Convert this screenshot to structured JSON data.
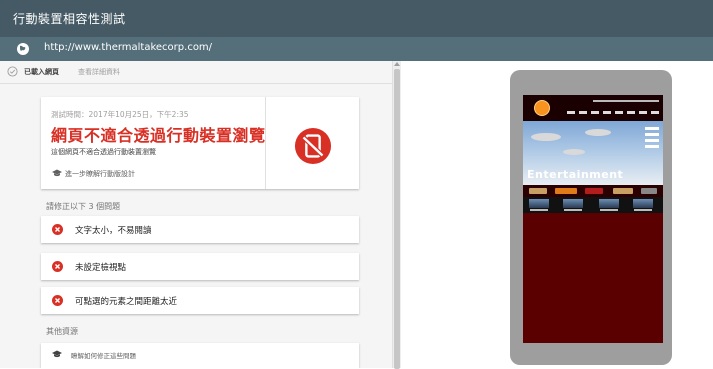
{
  "window": {
    "title": "行動裝置相容性測試"
  },
  "urlbar": {
    "url": "http://www.thermaltakecorp.com/",
    "icon": "globe-icon"
  },
  "subheader": {
    "loaded_label": "已載入網頁",
    "details_link": "查看詳細資料"
  },
  "result": {
    "test_time": "測試時間：2017年10月25日，下午2:35",
    "headline": "網頁不適合透過行動裝置瀏覽",
    "description": "這個網頁不適合透過行動裝置瀏覽",
    "learn_more": "進一步瞭解行動版設計",
    "status_icon": "not-mobile-friendly-icon",
    "status_color": "#d93025"
  },
  "issues": {
    "heading": "請修正以下 3 個問題",
    "items": [
      {
        "label": "文字太小，不易閱讀",
        "icon": "error-icon"
      },
      {
        "label": "未設定檢視點",
        "icon": "error-icon"
      },
      {
        "label": "可點選的元素之間距離太近",
        "icon": "error-icon"
      }
    ]
  },
  "resources": {
    "heading": "其他資源",
    "items": [
      {
        "label": "瞭解如何修正這些問題",
        "icon": "graduation-cap-icon"
      }
    ]
  },
  "preview": {
    "site_title": "Entertainment",
    "device_color": "#9e9e9e",
    "page_bg_color": "#5a0000"
  }
}
